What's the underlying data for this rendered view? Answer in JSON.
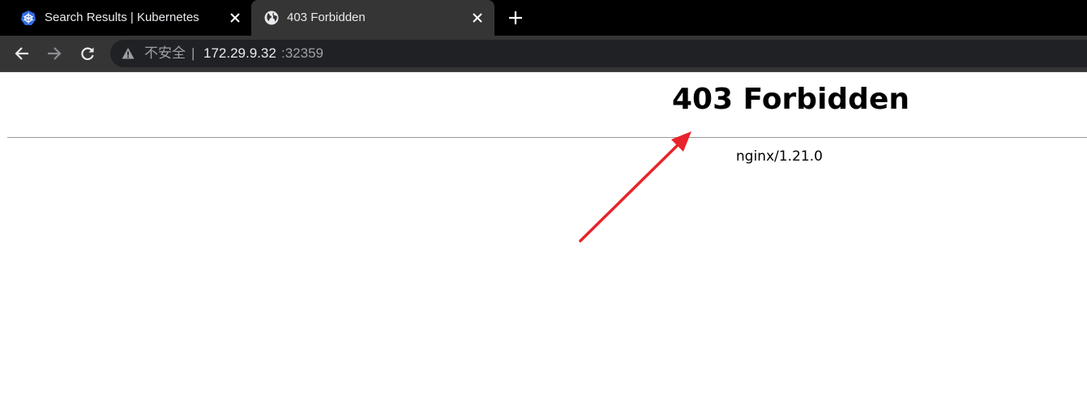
{
  "browser": {
    "tabs": [
      {
        "title": "Search Results | Kubernetes",
        "icon": "kubernetes-logo-icon",
        "active": false
      },
      {
        "title": "403 Forbidden",
        "icon": "globe-icon",
        "active": true
      }
    ],
    "address_bar": {
      "security_label": "不安全",
      "separator": "|",
      "host": "172.29.9.32",
      "port": ":32359"
    }
  },
  "page": {
    "heading": "403 Forbidden",
    "server_signature": "nginx/1.21.0"
  },
  "colors": {
    "tab_strip": "#000000",
    "active_tab": "#353535",
    "omnibox": "#202124",
    "annotation_arrow": "#e8232b"
  }
}
